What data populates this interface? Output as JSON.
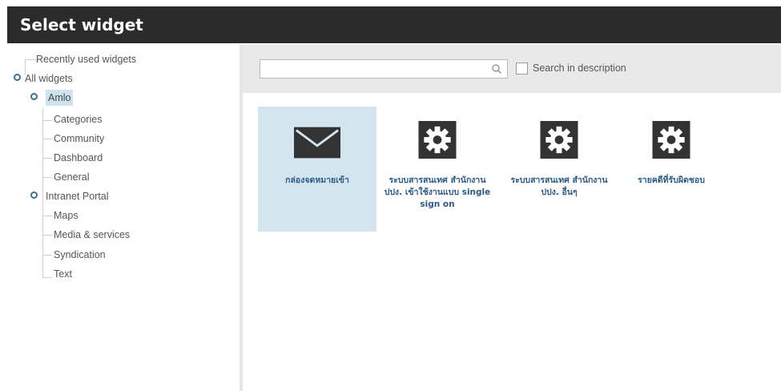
{
  "header": {
    "title": "Select widget"
  },
  "tree": {
    "recent": "Recently used widgets",
    "all": "All widgets",
    "amlo": "Amlo",
    "categories": "Categories",
    "community": "Community",
    "dashboard": "Dashboard",
    "general": "General",
    "intranet": "Intranet Portal",
    "maps": "Maps",
    "media": "Media & services",
    "syndication": "Syndication",
    "text": "Text"
  },
  "search": {
    "value": "",
    "placeholder": "",
    "desc_label": "Search in description"
  },
  "widgets": [
    {
      "label": "กล่องจดหมายเข้า",
      "icon": "envelope-icon"
    },
    {
      "label": "ระบบสารสนเทศ สำนักงาน ปปง. เข้าใช้งานแบบ single sign on",
      "icon": "gear-icon"
    },
    {
      "label": "ระบบสารสนเทศ สำนักงาน ปปง. อื่นๆ",
      "icon": "gear-icon"
    },
    {
      "label": "รายคดีที่รับผิดชอบ",
      "icon": "gear-icon"
    }
  ],
  "colors": {
    "titlebar": "#2b2b2b",
    "selected_bg": "#d3e6ef",
    "link": "#2d5b86",
    "icon": "#333333"
  }
}
